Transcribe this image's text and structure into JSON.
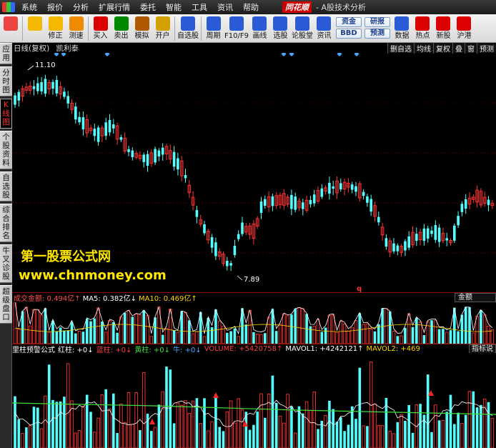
{
  "menubar": {
    "items": [
      "系统",
      "报价",
      "分析",
      "扩展行情",
      "委托",
      "智能",
      "工具",
      "资讯",
      "帮助"
    ],
    "brand": "同花顺",
    "title": "- A股技术分析"
  },
  "toolbar": {
    "buttons": [
      {
        "label": "",
        "icon": "grid-icon",
        "color": "#e44"
      },
      {
        "label": "",
        "icon": "back-arrow-icon",
        "color": "#f5b800"
      },
      {
        "label": "修正",
        "icon": "up-down-arrow-icon",
        "color": "#f5b800"
      },
      {
        "label": "测速",
        "icon": "clock-icon",
        "color": "#f08a00"
      },
      {
        "label": "买入",
        "icon": "buy-icon",
        "color": "#d00"
      },
      {
        "label": "卖出",
        "icon": "sell-icon",
        "color": "#080"
      },
      {
        "label": "模拟",
        "icon": "hammer-icon",
        "color": "#b05a00"
      },
      {
        "label": "开户",
        "icon": "lock-icon",
        "color": "#d4a000"
      },
      {
        "label": "自选股",
        "icon": "star-icon",
        "color": "#2a5bd7"
      },
      {
        "label": "周期",
        "icon": "period-clock-icon",
        "color": "#2a5bd7"
      },
      {
        "label": "F10/F9",
        "icon": "f10-icon",
        "color": "#2a5bd7"
      },
      {
        "label": "画线",
        "icon": "pen-icon",
        "color": "#2a5bd7"
      },
      {
        "label": "选股",
        "icon": "screen-icon",
        "color": "#2a5bd7"
      },
      {
        "label": "论股堂",
        "icon": "chat-icon",
        "color": "#2a5bd7"
      },
      {
        "label": "资讯",
        "icon": "news-icon",
        "color": "#2a5bd7"
      }
    ],
    "small_buttons_a": [
      "资金",
      "BBD"
    ],
    "small_buttons_b": [
      "研报",
      "预测"
    ],
    "buttons_right": [
      {
        "label": "数据",
        "icon": "pe-icon",
        "color": "#2a5bd7"
      },
      {
        "label": "热点",
        "icon": "hot-icon",
        "color": "#d00"
      },
      {
        "label": "新股",
        "icon": "new-stock-icon",
        "color": "#d00"
      },
      {
        "label": "沪港",
        "icon": "hk-icon",
        "color": "#d00"
      }
    ]
  },
  "sidebar": {
    "tabs": [
      "应用",
      "分时图",
      "K线图",
      "个股资料",
      "自选股",
      "综合排名",
      "牛叉诊股",
      "超级盘口"
    ],
    "active": 2
  },
  "kline": {
    "header_items": [
      "日线(复权)",
      "凯利泰"
    ],
    "right_tabs": [
      "删自选",
      "均线",
      "复权",
      "叠",
      "窗",
      "预测"
    ],
    "high_label": "11.10",
    "low_label": "7.89",
    "marker": "q"
  },
  "watermark": {
    "line1": "第一股票公式网",
    "line2": "www.chnmoney.com"
  },
  "volume": {
    "amount_label": "成交金额: 0.494亿↑",
    "ma5_label": "MA5: 0.382亿↓",
    "ma10_label": "MA10: 0.469亿↑",
    "tag": "金额"
  },
  "indicator": {
    "name": "里柱预警公式",
    "items": [
      {
        "text": "红柱: +0↓",
        "color": "#ffffff"
      },
      {
        "text": "蓝柱: +0↓",
        "color": "#ff4040"
      },
      {
        "text": "黄柱: +0↓",
        "color": "#40e040"
      },
      {
        "text": "牛: +0↓",
        "color": "#4aa8ff"
      },
      {
        "text": "VOLUME: +5420758↑",
        "color": "#ff4040"
      },
      {
        "text": "MAVOL1: +4242121↑",
        "color": "#ffffff"
      },
      {
        "text": "MAVOL2: +469",
        "color": "#ffd700"
      }
    ],
    "tag": "指标说"
  },
  "colors": {
    "up": "#ff3333",
    "down": "#54ffff",
    "grid": "#8b0000",
    "diamond": "#4aa8ff"
  }
}
